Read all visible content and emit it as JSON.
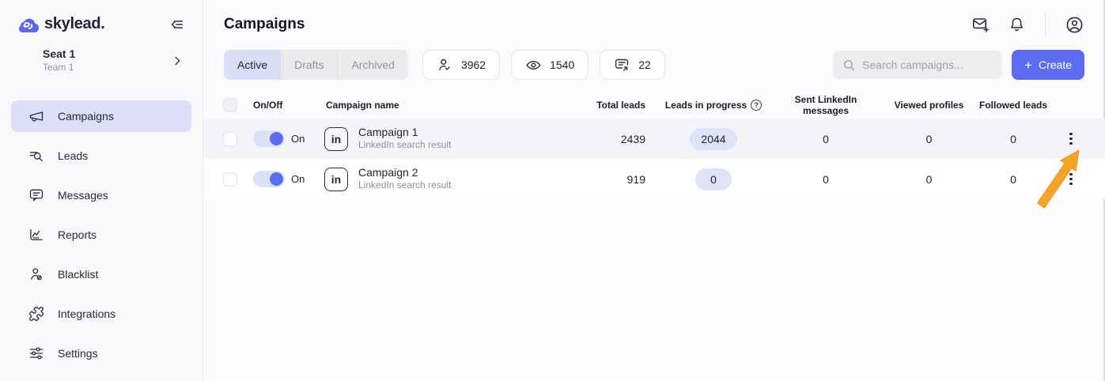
{
  "brand": {
    "name": "skylead.",
    "logo_icon": "cloud-icon"
  },
  "sidebar": {
    "seat": {
      "title": "Seat 1",
      "subtitle": "Team 1",
      "chevron_icon": "›"
    },
    "items": [
      {
        "label": "Campaigns",
        "icon": "megaphone-icon",
        "active": true
      },
      {
        "label": "Leads",
        "icon": "leads-search-icon",
        "active": false
      },
      {
        "label": "Messages",
        "icon": "message-bubble-icon",
        "active": false
      },
      {
        "label": "Reports",
        "icon": "reports-chart-icon",
        "active": false
      },
      {
        "label": "Blacklist",
        "icon": "blacklist-person-icon",
        "active": false
      },
      {
        "label": "Integrations",
        "icon": "puzzle-icon",
        "active": false
      },
      {
        "label": "Settings",
        "icon": "sliders-icon",
        "active": false
      }
    ]
  },
  "header": {
    "title": "Campaigns",
    "icons": [
      "mail-plus-icon",
      "bell-icon",
      "user-avatar-icon"
    ]
  },
  "toolbar": {
    "tabs": [
      {
        "label": "Active",
        "active": true
      },
      {
        "label": "Drafts",
        "active": false
      },
      {
        "label": "Archived",
        "active": false
      }
    ],
    "stats": [
      {
        "icon": "person-check-icon",
        "value": "3962"
      },
      {
        "icon": "eye-icon",
        "value": "1540"
      },
      {
        "icon": "message-sent-icon",
        "value": "22"
      }
    ],
    "search_placeholder": "Search campaigns...",
    "create_label": "Create",
    "create_plus": "+"
  },
  "table": {
    "columns": [
      "On/Off",
      "Campaign name",
      "Total leads",
      "Leads in progress",
      "Sent LinkedIn messages",
      "Viewed profiles",
      "Followed leads"
    ],
    "help_icon": "?",
    "linkedin_icon_label": "in",
    "rows": [
      {
        "toggle_label": "On",
        "toggle_state": "on",
        "name": "Campaign 1",
        "type": "LinkedIn search result",
        "total_leads": "2439",
        "leads_in_progress": "2044",
        "sent_messages": "0",
        "viewed_profiles": "0",
        "followed_leads": "0"
      },
      {
        "toggle_label": "On",
        "toggle_state": "on",
        "name": "Campaign 2",
        "type": "LinkedIn search result",
        "total_leads": "919",
        "leads_in_progress": "0",
        "sent_messages": "0",
        "viewed_profiles": "0",
        "followed_leads": "0"
      }
    ]
  },
  "annotation": {
    "type": "arrow",
    "color": "#F4A428",
    "points_to": "row-1 kebab menu"
  },
  "colors": {
    "accent": "#5b6cf0",
    "active_nav_pill": "#dcdff7",
    "active_tab": "#d9ddf6",
    "badge_bg": "#dfe3f8",
    "arrow": "#f4a428",
    "sidebar_bg": "#f8f8fb",
    "row_alt_bg": "#f4f5f8"
  }
}
